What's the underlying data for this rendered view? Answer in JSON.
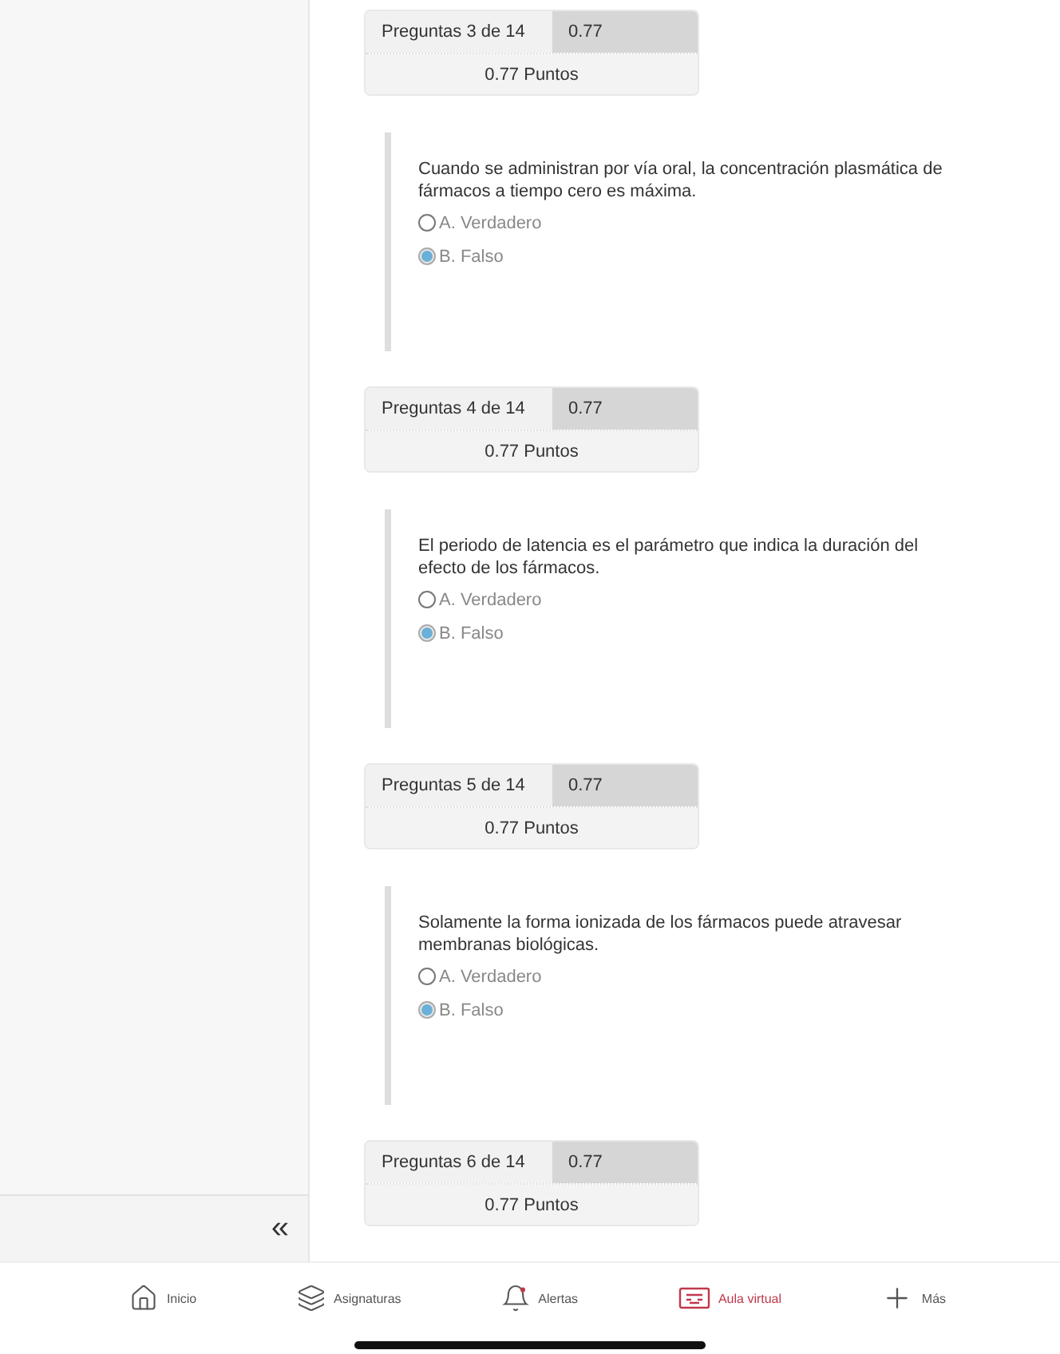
{
  "sidebar": {
    "collapse_label": "«"
  },
  "questions": [
    {
      "header": "Preguntas 3 de 14",
      "score": "0.77",
      "points": "0.77 Puntos",
      "text": "Cuando se administran por vía oral, la concentración plasmática de fármacos a tiempo cero es máxima.",
      "options": [
        {
          "label": "A. Verdadero",
          "selected": false
        },
        {
          "label": "B. Falso",
          "selected": true
        }
      ]
    },
    {
      "header": "Preguntas 4 de 14",
      "score": "0.77",
      "points": "0.77 Puntos",
      "text": "El periodo de latencia es el parámetro que indica la duración del efecto de los fármacos.",
      "options": [
        {
          "label": "A. Verdadero",
          "selected": false
        },
        {
          "label": "B. Falso",
          "selected": true
        }
      ]
    },
    {
      "header": "Preguntas 5 de 14",
      "score": "0.77",
      "points": "0.77 Puntos",
      "text": "Solamente la forma ionizada de los fármacos puede atravesar membranas biológicas.",
      "options": [
        {
          "label": "A. Verdadero",
          "selected": false
        },
        {
          "label": "B. Falso",
          "selected": true
        }
      ]
    },
    {
      "header": "Preguntas 6 de 14",
      "score": "0.77",
      "points": "0.77 Puntos"
    }
  ],
  "bottom_nav": [
    {
      "kind": "home",
      "label": "Inicio",
      "selected": false
    },
    {
      "kind": "layers",
      "label": "Asignaturas",
      "selected": false
    },
    {
      "kind": "bell",
      "label": "Alertas",
      "selected": false
    },
    {
      "kind": "classroom",
      "label": "Aula virtual",
      "selected": true
    },
    {
      "kind": "plus",
      "label": "Más",
      "selected": false
    }
  ]
}
